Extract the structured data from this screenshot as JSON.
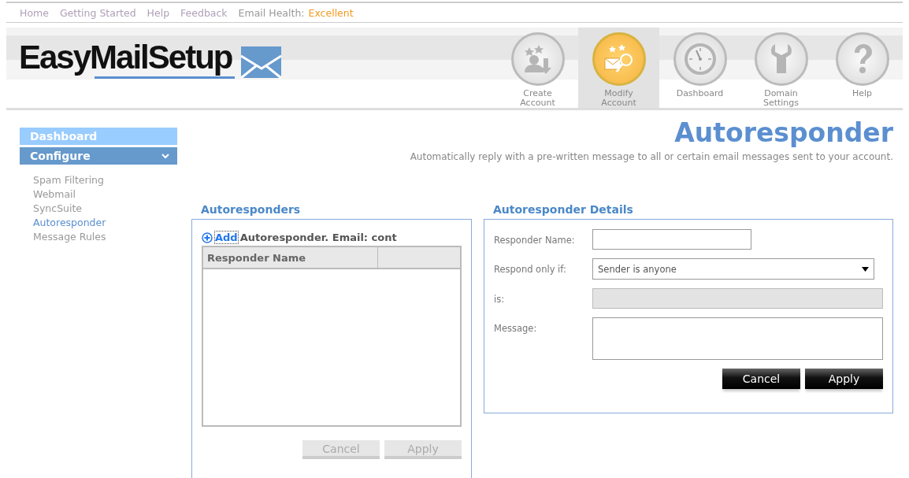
{
  "top_nav": {
    "links": [
      {
        "label": "Home"
      },
      {
        "label": "Getting Started"
      },
      {
        "label": "Help"
      },
      {
        "label": "Feedback"
      }
    ],
    "health": {
      "label": "Email Health:",
      "value": "Excellent"
    }
  },
  "header": {
    "logo": "EasyMailSetup",
    "tiles": [
      {
        "label": "Create Account",
        "kind": "create",
        "selected": false
      },
      {
        "label": "Modify Account",
        "kind": "modify",
        "selected": true
      },
      {
        "label": "Dashboard",
        "kind": "dashboard",
        "selected": false
      },
      {
        "label": "Domain Settings",
        "kind": "domain",
        "selected": false
      },
      {
        "label": "Help",
        "kind": "help",
        "selected": false
      }
    ]
  },
  "sidebar": {
    "dashboard": "Dashboard",
    "section": {
      "label": "Configure",
      "expanded": true,
      "items": [
        {
          "label": "Spam Filtering",
          "selected": false
        },
        {
          "label": "Webmail",
          "selected": false
        },
        {
          "label": "SyncSuite",
          "selected": false
        },
        {
          "label": "Autoresponder",
          "selected": true
        },
        {
          "label": "Message Rules",
          "selected": false
        }
      ]
    }
  },
  "page": {
    "title": "Autoresponder",
    "subtitle": "Automatically reply with a pre-written message to all or certain email messages sent to your account."
  },
  "list_panel": {
    "title": "Autoresponders",
    "add_link": "Add",
    "add_text": "Autoresponder. Email: cont",
    "columns": [
      "Responder Name"
    ],
    "buttons": [
      {
        "label": "Cancel",
        "disabled": true
      },
      {
        "label": "Apply",
        "disabled": true
      }
    ]
  },
  "details_panel": {
    "title": "Autoresponder Details",
    "fields": [
      {
        "kind": "text",
        "label": "Responder Name:",
        "disabled": false
      },
      {
        "kind": "select",
        "label": "Respond only if:",
        "value": "Sender is anyone",
        "disabled": false
      },
      {
        "kind": "text",
        "label": "is:",
        "disabled": true
      },
      {
        "kind": "textarea",
        "label": "Message:",
        "disabled": false
      }
    ],
    "buttons": [
      {
        "label": "Cancel",
        "disabled": false
      },
      {
        "label": "Apply",
        "disabled": false
      }
    ]
  }
}
